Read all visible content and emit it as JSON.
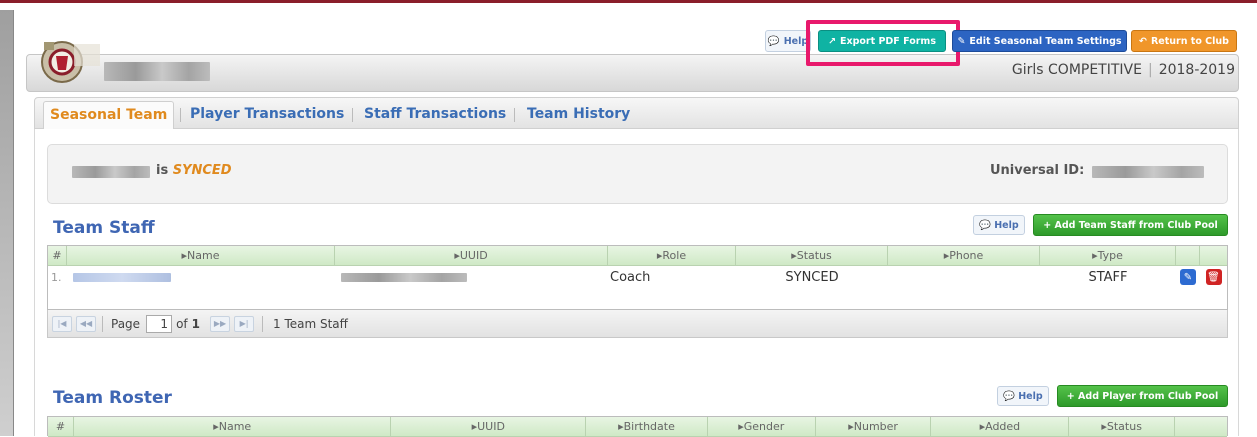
{
  "header": {
    "season_division": "Girls COMPETITIVE",
    "season_year": "2018-2019",
    "buttons": {
      "help": "Help",
      "export": "Export PDF Forms",
      "edit_settings": "Edit Seasonal Team Settings",
      "return": "Return to Club"
    }
  },
  "tabs": [
    {
      "label": "Seasonal Team",
      "active": true
    },
    {
      "label": "Player Transactions",
      "active": false
    },
    {
      "label": "Staff Transactions",
      "active": false
    },
    {
      "label": "Team History",
      "active": false
    }
  ],
  "status_box": {
    "is_text": "is",
    "status": "SYNCED",
    "universal_id_label": "Universal ID:"
  },
  "team_staff": {
    "title": "Team Staff",
    "help": "Help",
    "add_button": "+ Add Team Staff from Club Pool",
    "columns": [
      "#",
      "Name",
      "UUID",
      "Role",
      "Status",
      "Phone",
      "Type",
      "",
      ""
    ],
    "rows": [
      {
        "num": "1.",
        "role": "Coach",
        "status": "SYNCED",
        "phone": "",
        "type": "STAFF"
      }
    ],
    "pager": {
      "page_label": "Page",
      "page_value": "1",
      "of_label": "of",
      "total_pages": "1",
      "count_text": "1 Team Staff"
    }
  },
  "team_roster": {
    "title": "Team Roster",
    "help": "Help",
    "add_button": "+ Add Player from Club Pool",
    "columns": [
      "#",
      "Name",
      "UUID",
      "Birthdate",
      "Gender",
      "Number",
      "Added",
      "Status",
      ""
    ]
  },
  "colors": {
    "accent_blue": "#3f66b3",
    "active_tab": "#e08a1e",
    "export_teal": "#0fb3a3",
    "highlight_pink": "#e8196c",
    "green_button": "#2e9a2a"
  }
}
